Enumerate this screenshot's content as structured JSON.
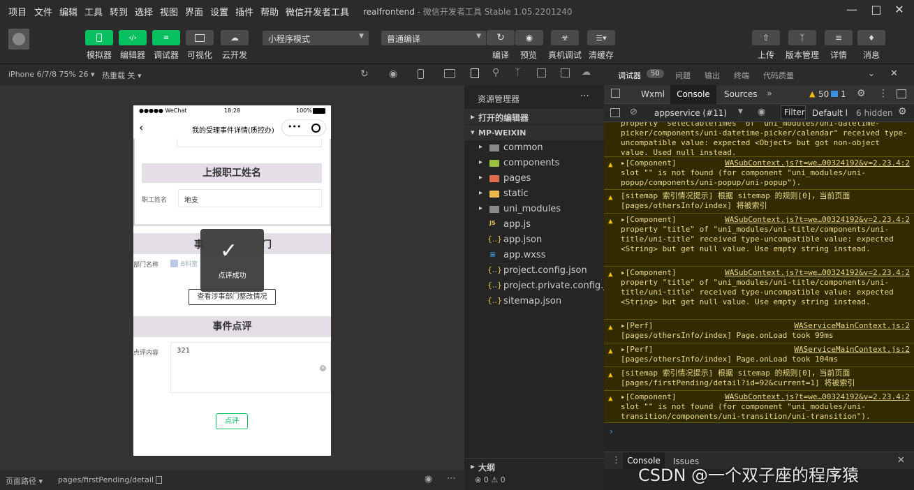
{
  "menubar": {
    "items": [
      "项目",
      "文件",
      "编辑",
      "工具",
      "转到",
      "选择",
      "视图",
      "界面",
      "设置",
      "插件",
      "帮助",
      "微信开发者工具"
    ],
    "project": "realfrontend",
    "title": "微信开发者工具 Stable 1.05.2201240"
  },
  "toolbar": {
    "left_buttons": [
      "模拟器",
      "编辑器",
      "调试器",
      "可视化",
      "云开发"
    ],
    "mode_select": "小程序模式",
    "compile_select": "普通编译",
    "middle_buttons": [
      "编译",
      "预览",
      "真机调试",
      "清缓存"
    ],
    "right_buttons": [
      "上传",
      "版本管理",
      "详情",
      "消息"
    ]
  },
  "simulator": {
    "device": "iPhone 6/7/8 75% 26",
    "hot_reload": "热重载 关",
    "status_bar": {
      "carrier": "●●●●● WeChat",
      "time": "18:28",
      "battery": "100%"
    },
    "nav_title": "我的受理事件详情(质控办)",
    "section_report_staff": "上报职工姓名",
    "staff_label": "职工姓名",
    "staff_value": "地支",
    "section_dept_left": "事",
    "section_dept_right": "门",
    "dept_label": "部门名称",
    "dept_value": "B科室",
    "dept_button": "查看涉事部门整改情况",
    "section_comment": "事件点评",
    "comment_label": "点评内容",
    "comment_value": "321",
    "submit_button": "点评",
    "toast": "点评成功"
  },
  "bottombar": {
    "path_label": "页面路径",
    "path": "pages/firstPending/detail"
  },
  "explorer": {
    "title": "资源管理器",
    "open_editors": "打开的编辑器",
    "project": "MP-WEIXIN",
    "folders": [
      "common",
      "components",
      "pages",
      "static",
      "uni_modules"
    ],
    "files": [
      "app.js",
      "app.json",
      "app.wxss",
      "project.config.json",
      "project.private.config.js...",
      "sitemap.json"
    ],
    "outline": "大纲",
    "status": "⊗ 0 ⚠ 0"
  },
  "devtools": {
    "tabs": [
      "调试器",
      "问题",
      "输出",
      "终端",
      "代码质量"
    ],
    "debugger_badge": "50",
    "inner_tabs": [
      "Wxml",
      "Console",
      "Sources"
    ],
    "warn_count": "50",
    "info_count": "1",
    "context": "appservice (#11)",
    "filter": "Filter",
    "levels": "Default l",
    "hidden": "6 hidden",
    "logs": [
      {
        "head": "",
        "src": "",
        "text": "property \"selectableTimes\" of \"uni_modules/uni-datetime-picker/components/uni-datetime-picker/calendar\" received type-uncompatible value: expected <Object> but got non-object value. Used null instead."
      },
      {
        "head": "▸[Component]",
        "src": "WASubContext.js?t=we…00324192&v=2.23.4:2",
        "text": "slot \"\" is not found (for component \"uni_modules/uni-popup/components/uni-popup/uni-popup\")."
      },
      {
        "head": "[sitemap 索引情况提示] 根据 sitemap 的规则[0]，当前页面 [pages/othersInfo/index] 将被索引",
        "src": "",
        "text": ""
      },
      {
        "head": "▸[Component]",
        "src": "WASubContext.js?t=we…00324192&v=2.23.4:2",
        "text": "property \"title\" of \"uni_modules/uni-title/components/uni-title/uni-title\" received type-uncompatible value: expected <String> but get null value. Use empty string instead."
      },
      {
        "head": "▸[Component]",
        "src": "WASubContext.js?t=we…00324192&v=2.23.4:2",
        "text": "property \"title\" of \"uni_modules/uni-title/components/uni-title/uni-title\" received type-uncompatible value: expected <String> but get null value. Use empty string instead."
      },
      {
        "head": "▸[Perf]",
        "src": "WAServiceMainContext.js:2",
        "text": "[pages/othersInfo/index] Page.onLoad took 99ms"
      },
      {
        "head": "▸[Perf]",
        "src": "WAServiceMainContext.js:2",
        "text": "[pages/othersInfo/index] Page.onLoad took 104ms"
      },
      {
        "head": "[sitemap 索引情况提示] 根据 sitemap 的规则[0]，当前页面 [pages/firstPending/detail?id=92&current=1] 将被索引",
        "src": "",
        "text": ""
      },
      {
        "head": "▸[Component]",
        "src": "WASubContext.js?t=we…00324192&v=2.23.4:2",
        "text": "slot \"\" is not found (for component \"uni_modules/uni-transition/components/uni-transition/uni-transition\")."
      }
    ],
    "bottom_tabs": [
      "Console",
      "Issues"
    ]
  },
  "watermark": "CSDN @一个双子座的程序猿"
}
